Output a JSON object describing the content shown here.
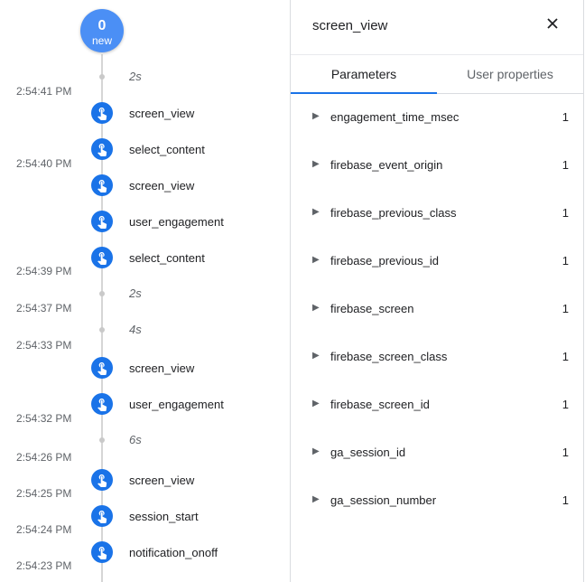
{
  "timeline": {
    "new_count": "0",
    "new_label": "new",
    "times": [
      "2:54:41 PM",
      "2:54:40 PM",
      "2:54:39 PM",
      "2:54:37 PM",
      "2:54:33 PM",
      "2:54:32 PM",
      "2:54:26 PM",
      "2:54:25 PM",
      "2:54:24 PM",
      "2:54:23 PM"
    ],
    "gaps": [
      "2s",
      "2s",
      "4s",
      "6s"
    ],
    "events": [
      "screen_view",
      "select_content",
      "screen_view",
      "user_engagement",
      "select_content",
      "screen_view",
      "user_engagement",
      "screen_view",
      "session_start",
      "notification_onoff"
    ]
  },
  "panel": {
    "title": "screen_view",
    "tabs": [
      "Parameters",
      "User properties"
    ],
    "params": [
      {
        "name": "engagement_time_msec",
        "value": "1"
      },
      {
        "name": "firebase_event_origin",
        "value": "1"
      },
      {
        "name": "firebase_previous_class",
        "value": "1"
      },
      {
        "name": "firebase_previous_id",
        "value": "1"
      },
      {
        "name": "firebase_screen",
        "value": "1"
      },
      {
        "name": "firebase_screen_class",
        "value": "1"
      },
      {
        "name": "firebase_screen_id",
        "value": "1"
      },
      {
        "name": "ga_session_id",
        "value": "1"
      },
      {
        "name": "ga_session_number",
        "value": "1"
      }
    ]
  },
  "icons": {
    "event": "touch-app-icon",
    "close": "close-icon",
    "expand": "triangle-right-icon"
  },
  "colors": {
    "event_icon": "#1a73e8",
    "new_badge": "#4b8ff5",
    "active_tab": "#1a73e8"
  }
}
